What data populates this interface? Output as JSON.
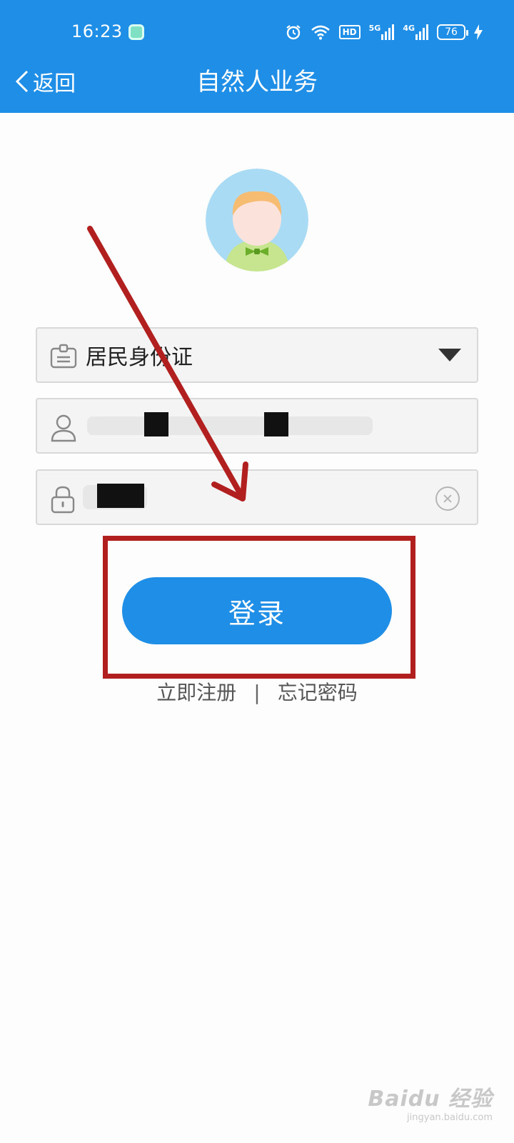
{
  "status_bar": {
    "time": "16:23",
    "hd": "HD",
    "net1": "5G",
    "net2": "4G",
    "battery": "76"
  },
  "header": {
    "back_label": "返回",
    "title": "自然人业务"
  },
  "form": {
    "id_type": "居民身份证"
  },
  "login": {
    "button_label": "登录"
  },
  "links": {
    "register": "立即注册",
    "separator": "|",
    "forgot": "忘记密码"
  },
  "watermark": {
    "brand": "Baidu 经验",
    "url": "jingyan.baidu.com"
  },
  "colors": {
    "accent": "#1f8ee6",
    "annotation": "#b21f1f"
  }
}
